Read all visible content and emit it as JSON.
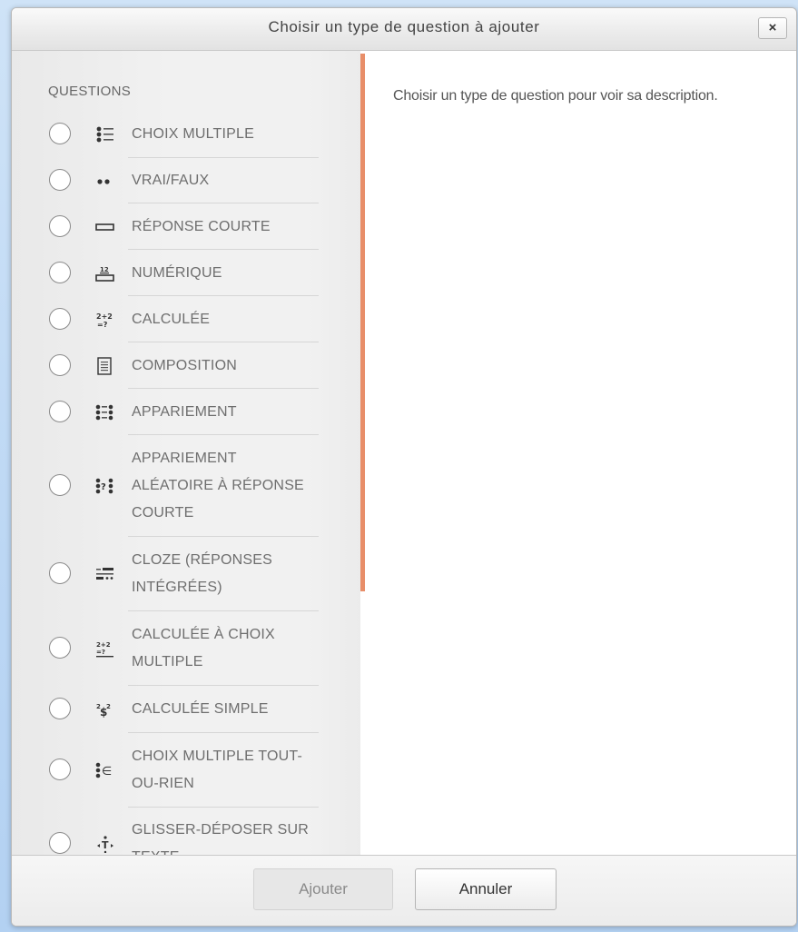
{
  "dialog": {
    "title": "Choisir un type de question à ajouter",
    "close_label": "×"
  },
  "sidebar": {
    "section_label": "QUESTIONS",
    "items": [
      {
        "label": "CHOIX MULTIPLE",
        "icon": "multichoice-icon"
      },
      {
        "label": "VRAI/FAUX",
        "icon": "truefalse-icon"
      },
      {
        "label": "RÉPONSE COURTE",
        "icon": "shortanswer-icon"
      },
      {
        "label": "NUMÉRIQUE",
        "icon": "numerical-icon"
      },
      {
        "label": "CALCULÉE",
        "icon": "calculated-icon"
      },
      {
        "label": "COMPOSITION",
        "icon": "essay-icon"
      },
      {
        "label": "APPARIEMENT",
        "icon": "match-icon"
      },
      {
        "label": "APPARIEMENT ALÉATOIRE À RÉPONSE COURTE",
        "icon": "randomsamatch-icon"
      },
      {
        "label": "CLOZE (RÉPONSES INTÉGRÉES)",
        "icon": "multianswer-icon"
      },
      {
        "label": "CALCULÉE À CHOIX MULTIPLE",
        "icon": "calculatedmulti-icon"
      },
      {
        "label": "CALCULÉE SIMPLE",
        "icon": "calculatedsimple-icon"
      },
      {
        "label": "CHOIX MULTIPLE TOUT-OU-RIEN",
        "icon": "multichoiceset-icon"
      },
      {
        "label": "GLISSER-DÉPOSER SUR TEXTE",
        "icon": "ddwtos-icon"
      }
    ]
  },
  "content": {
    "description": "Choisir un type de question pour voir sa description."
  },
  "footer": {
    "add_label": "Ajouter",
    "cancel_label": "Annuler"
  }
}
